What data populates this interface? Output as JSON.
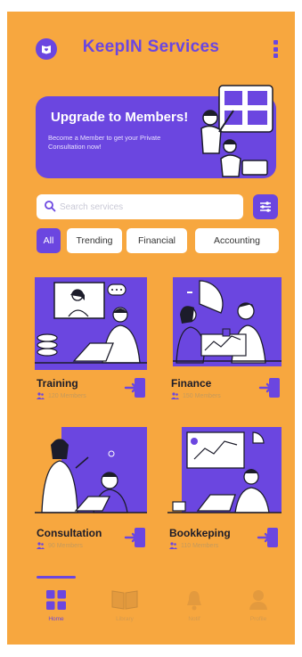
{
  "app": {
    "title": "KeepIN Services",
    "logo_icon": "book-heart-icon",
    "menu_icon": "more-vertical-icon"
  },
  "banner": {
    "title": "Upgrade to Members!",
    "subtitle": "Become a Member to get your Private Consultation now!"
  },
  "search": {
    "placeholder": "Search services",
    "value": ""
  },
  "chips": [
    {
      "label": "All",
      "active": true
    },
    {
      "label": "Trending",
      "active": false
    },
    {
      "label": "Financial",
      "active": false
    },
    {
      "label": "Accounting",
      "active": false
    }
  ],
  "cards": [
    {
      "title": "Training",
      "meta": "120 Members"
    },
    {
      "title": "Finance",
      "meta": "150 Members"
    },
    {
      "title": "Consultation",
      "meta": "90 Members"
    },
    {
      "title": "Bookkeping",
      "meta": "110 Members"
    }
  ],
  "nav": [
    {
      "label": "Home",
      "icon": "grid-icon",
      "active": true
    },
    {
      "label": "Library",
      "icon": "book-open-icon",
      "active": false
    },
    {
      "label": "Notif",
      "icon": "bell-icon",
      "active": false
    },
    {
      "label": "Profile",
      "icon": "user-icon",
      "active": false
    }
  ],
  "colors": {
    "background": "#f7a73f",
    "accent": "#6b46e0",
    "text_dark": "#1c1c2a",
    "surface": "#ffffff"
  }
}
